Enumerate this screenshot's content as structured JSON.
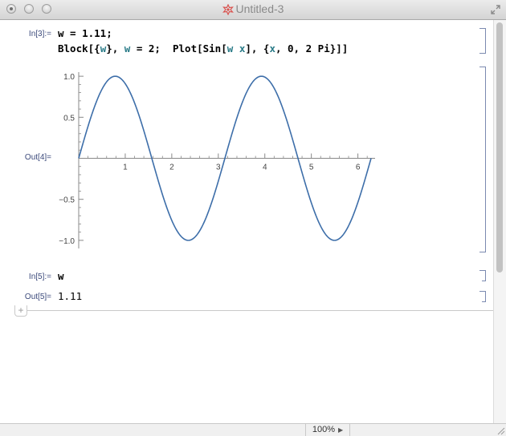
{
  "window": {
    "title": "Untitled-3"
  },
  "notebook": {
    "cells": [
      {
        "label": "In[3]:=",
        "line1": {
          "a": "w = ",
          "b": "1.11",
          "c": ";"
        },
        "line2": {
          "block": "Block[{",
          "w1": "w",
          "mid": "}, ",
          "w2": "w",
          "eq": " = 2;  Plot[Sin[",
          "w3": "w",
          "sp": " ",
          "x1": "x",
          "end1": "], {",
          "x2": "x",
          "end2": ", 0, 2 Pi}]]"
        }
      },
      {
        "label": "Out[4]="
      },
      {
        "label": "In[5]:=",
        "code": "w"
      },
      {
        "label": "Out[5]=",
        "value": "1.11"
      }
    ],
    "insert_symbol": "+"
  },
  "chart_data": {
    "type": "line",
    "function": "Sin[2 x]",
    "x_range": [
      0,
      6.283185
    ],
    "y_range": [
      -1.05,
      1.05
    ],
    "x_ticks": [
      1,
      2,
      3,
      4,
      5,
      6
    ],
    "x_tick_labels": [
      "1",
      "2",
      "3",
      "4",
      "5",
      "6"
    ],
    "y_ticks": [
      -1.0,
      -0.5,
      0.5,
      1.0
    ],
    "y_tick_labels": [
      "-1.0",
      "-0.5",
      "0.5",
      "1.0"
    ],
    "line_color": "#3d6ea9",
    "title": "",
    "xlabel": "",
    "ylabel": ""
  },
  "statusbar": {
    "zoom": "100%"
  }
}
